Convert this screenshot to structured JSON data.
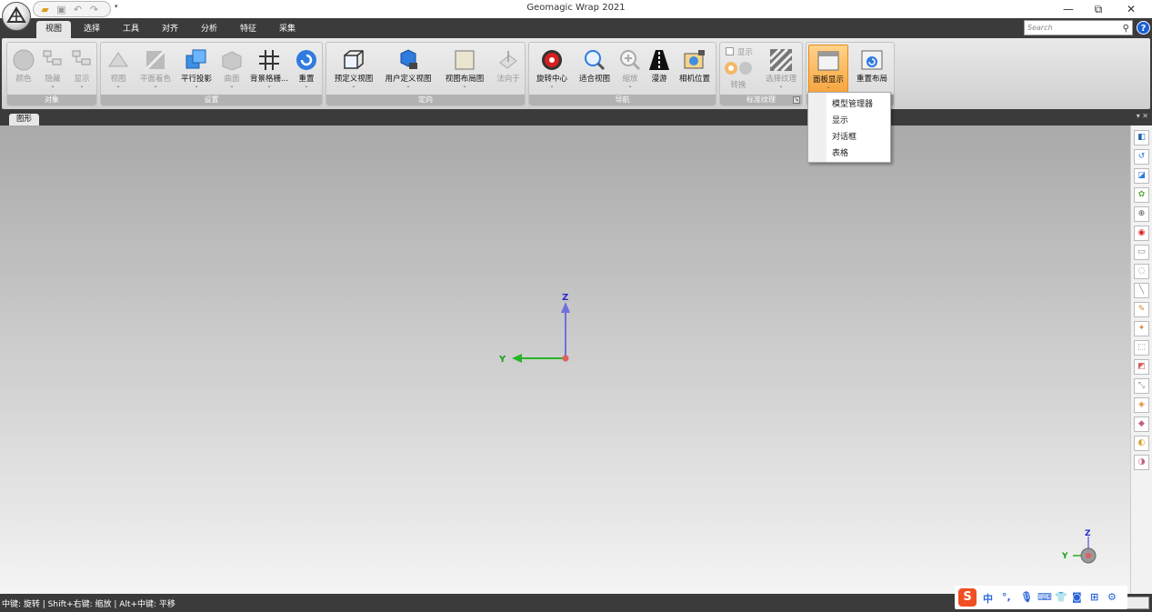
{
  "window": {
    "title": "Geomagic Wrap 2021",
    "minimize": "—",
    "maximize": "⧉",
    "close": "✕"
  },
  "quick_access": {
    "open_icon": "open-folder-icon",
    "save_icon": "save-icon",
    "undo_icon": "undo-icon",
    "redo_icon": "redo-icon",
    "dropdown": "▾"
  },
  "tabs": [
    "视图",
    "选择",
    "工具",
    "对齐",
    "分析",
    "特征",
    "采集"
  ],
  "active_tab": "视图",
  "search": {
    "placeholder": "Search",
    "icon": "magnifier-icon"
  },
  "help": "?",
  "ribbon": {
    "groups": [
      {
        "title": "对象",
        "buttons": [
          {
            "label": "颜色",
            "enabled": false
          },
          {
            "label": "隐藏",
            "enabled": false
          },
          {
            "label": "显示",
            "enabled": false
          }
        ]
      },
      {
        "title": "设置",
        "buttons": [
          {
            "label": "视图",
            "enabled": false
          },
          {
            "label": "平面着色",
            "enabled": false
          },
          {
            "label": "平行投影",
            "enabled": true
          },
          {
            "label": "曲面",
            "enabled": false
          },
          {
            "label": "背景格栅...",
            "enabled": true
          },
          {
            "label": "重置",
            "enabled": true
          }
        ]
      },
      {
        "title": "定向",
        "buttons": [
          {
            "label": "预定义视图",
            "enabled": true
          },
          {
            "label": "用户定义视图",
            "enabled": true
          },
          {
            "label": "视图布局图",
            "enabled": true
          },
          {
            "label": "法向于",
            "enabled": false
          }
        ]
      },
      {
        "title": "导航",
        "buttons": [
          {
            "label": "旋转中心",
            "enabled": true
          },
          {
            "label": "适合视图",
            "enabled": true
          },
          {
            "label": "缩放",
            "enabled": false
          },
          {
            "label": "漫游",
            "enabled": true
          },
          {
            "label": "相机位置",
            "enabled": true
          }
        ]
      },
      {
        "title": "标准纹理",
        "buttons": [
          {
            "label": "显示",
            "enabled": false
          },
          {
            "label": "转换",
            "enabled": false
          },
          {
            "label": "选择纹理",
            "enabled": false
          }
        ]
      },
      {
        "title": "",
        "buttons": [
          {
            "label": "面板显示",
            "enabled": true
          },
          {
            "label": "重置布局",
            "enabled": true
          }
        ]
      }
    ]
  },
  "panel_dropdown": {
    "items": [
      "模型管理器",
      "显示",
      "对话框",
      "表格"
    ]
  },
  "work_tab": "图形",
  "viewport": {
    "axis_z": "Z",
    "axis_y": "Y",
    "colors": {
      "z_axis": "#7070e0",
      "y_axis": "#28b428",
      "origin": "#e06060"
    }
  },
  "status": {
    "hint": "中键: 旋转 | Shift+右键: 缩放 | Alt+中键: 平移"
  },
  "ime": {
    "items": [
      "中",
      "°,",
      "mic-icon",
      "keyboard-icon",
      "shirt-icon",
      "gamepad-icon",
      "grid-icon",
      "gear-icon"
    ]
  },
  "colors": {
    "dark_bar": "#3b3b3b",
    "accent_orange": "#f6a43d",
    "help_blue": "#1a5fd6"
  }
}
